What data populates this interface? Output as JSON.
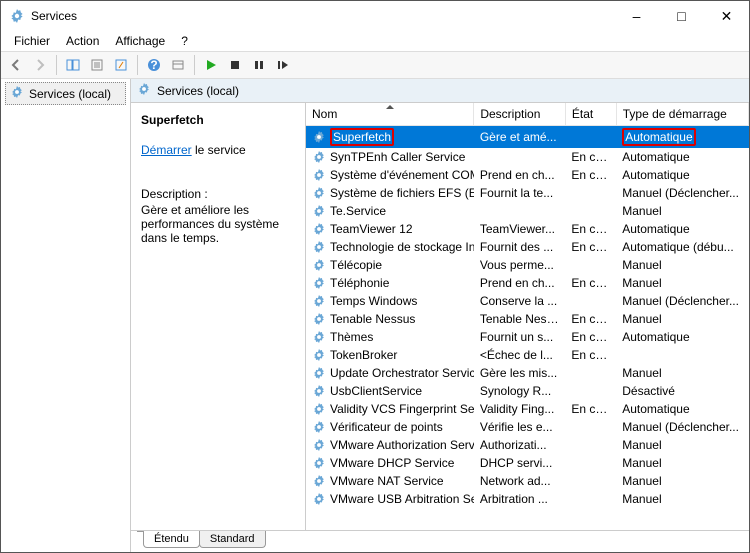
{
  "window": {
    "title": "Services"
  },
  "menu": {
    "file": "Fichier",
    "action": "Action",
    "view": "Affichage",
    "help": "?"
  },
  "sidebar": {
    "root": "Services (local)"
  },
  "header": {
    "label": "Services (local)"
  },
  "detail": {
    "selected": "Superfetch",
    "startLink": "Démarrer",
    "startRest": " le service",
    "descLabel": "Description :",
    "descText": "Gère et améliore les performances du système dans le temps."
  },
  "columns": {
    "name": "Nom",
    "description": "Description",
    "state": "État",
    "startup": "Type de démarrage"
  },
  "colWidths": {
    "name": "165px",
    "description": "90px",
    "state": "50px",
    "startup": "130px"
  },
  "services": [
    {
      "name": "Superfetch",
      "desc": "Gère et amé...",
      "state": "",
      "startup": "Automatique",
      "selected": true,
      "hlName": true,
      "hlStartup": true
    },
    {
      "name": "SynTPEnh Caller Service",
      "desc": "",
      "state": "En co...",
      "startup": "Automatique"
    },
    {
      "name": "Système d'événement COM+",
      "desc": "Prend en ch...",
      "state": "En co...",
      "startup": "Automatique"
    },
    {
      "name": "Système de fichiers EFS (En...",
      "desc": "Fournit la te...",
      "state": "",
      "startup": "Manuel (Déclencher..."
    },
    {
      "name": "Te.Service",
      "desc": "",
      "state": "",
      "startup": "Manuel"
    },
    {
      "name": "TeamViewer 12",
      "desc": "TeamViewer...",
      "state": "En co...",
      "startup": "Automatique"
    },
    {
      "name": "Technologie de stockage In...",
      "desc": "Fournit des ...",
      "state": "En co...",
      "startup": "Automatique (débu..."
    },
    {
      "name": "Télécopie",
      "desc": "Vous perme...",
      "state": "",
      "startup": "Manuel"
    },
    {
      "name": "Téléphonie",
      "desc": "Prend en ch...",
      "state": "En co...",
      "startup": "Manuel"
    },
    {
      "name": "Temps Windows",
      "desc": "Conserve la ...",
      "state": "",
      "startup": "Manuel (Déclencher..."
    },
    {
      "name": "Tenable Nessus",
      "desc": "Tenable Ness...",
      "state": "En co...",
      "startup": "Manuel"
    },
    {
      "name": "Thèmes",
      "desc": "Fournit un s...",
      "state": "En co...",
      "startup": "Automatique"
    },
    {
      "name": "TokenBroker",
      "desc": "<Échec de l...",
      "state": "En co...",
      "startup": ""
    },
    {
      "name": "Update Orchestrator Service",
      "desc": "Gère les mis...",
      "state": "",
      "startup": "Manuel"
    },
    {
      "name": "UsbClientService",
      "desc": "Synology R...",
      "state": "",
      "startup": "Désactivé"
    },
    {
      "name": "Validity VCS Fingerprint Ser...",
      "desc": "Validity Fing...",
      "state": "En co...",
      "startup": "Automatique"
    },
    {
      "name": "Vérificateur de points",
      "desc": "Vérifie les e...",
      "state": "",
      "startup": "Manuel (Déclencher..."
    },
    {
      "name": "VMware Authorization Servi...",
      "desc": "Authorizati...",
      "state": "",
      "startup": "Manuel"
    },
    {
      "name": "VMware DHCP Service",
      "desc": "DHCP servi...",
      "state": "",
      "startup": "Manuel"
    },
    {
      "name": "VMware NAT Service",
      "desc": "Network ad...",
      "state": "",
      "startup": "Manuel"
    },
    {
      "name": "VMware USB Arbitration Ser...",
      "desc": "Arbitration ...",
      "state": "",
      "startup": "Manuel"
    }
  ],
  "tabs": {
    "extended": "Étendu",
    "standard": "Standard"
  }
}
